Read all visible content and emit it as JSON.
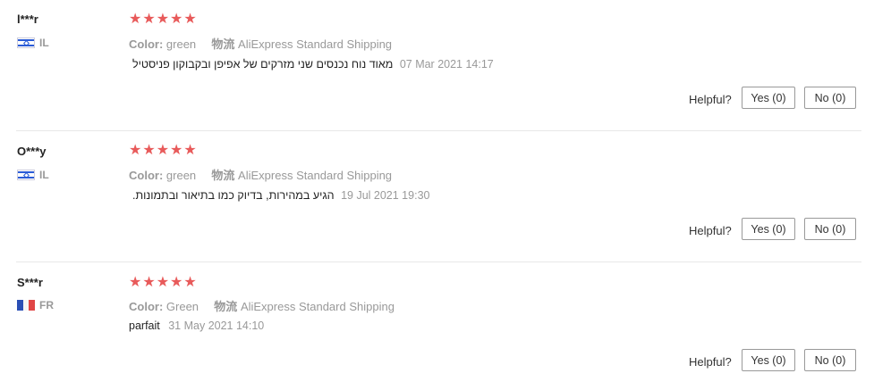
{
  "rating_glyph": "★",
  "colors": {
    "star": "#e85a5a",
    "muted": "#999999",
    "divider": "#e8e8e8"
  },
  "reviews": [
    {
      "user": "l***r",
      "country_code": "IL",
      "flag_icon": "israel-flag-icon",
      "stars": 5,
      "color_label": "Color:",
      "color_value": "green",
      "shipping_label": "物流",
      "shipping_value": "AliExpress Standard Shipping",
      "text": "מאוד נוח נכנסים שני מזרקים של אפיפן ובקבוקון פניסטיל",
      "date": "07 Mar 2021 14:17",
      "helpful_label": "Helpful?",
      "yes_label": "Yes (0)",
      "no_label": "No (0)"
    },
    {
      "user": "O***y",
      "country_code": "IL",
      "flag_icon": "israel-flag-icon",
      "stars": 5,
      "color_label": "Color:",
      "color_value": "green",
      "shipping_label": "物流",
      "shipping_value": "AliExpress Standard Shipping",
      "text": "הגיע במהירות, בדיוק כמו בתיאור ובתמונות.",
      "date": "19 Jul 2021 19:30",
      "helpful_label": "Helpful?",
      "yes_label": "Yes (0)",
      "no_label": "No (0)"
    },
    {
      "user": "S***r",
      "country_code": "FR",
      "flag_icon": "france-flag-icon",
      "stars": 5,
      "color_label": "Color:",
      "color_value": "Green",
      "shipping_label": "物流",
      "shipping_value": "AliExpress Standard Shipping",
      "text": "parfait",
      "date": "31 May 2021 14:10",
      "helpful_label": "Helpful?",
      "yes_label": "Yes (0)",
      "no_label": "No (0)"
    }
  ]
}
